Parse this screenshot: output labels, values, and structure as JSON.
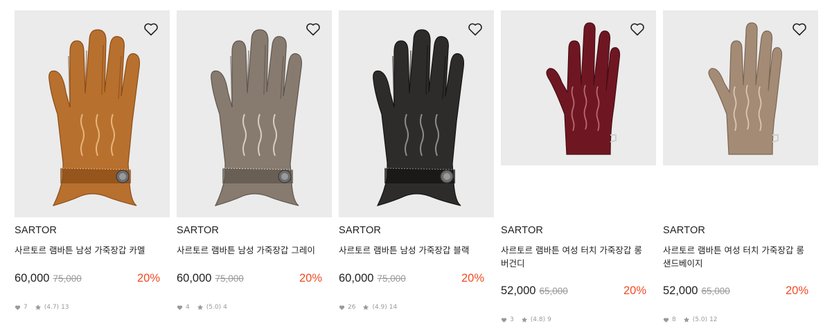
{
  "products": [
    {
      "brand": "SARTOR",
      "name": "사르토르 램바튼 남성 가죽장갑 카멜",
      "price": "60,000",
      "original_price": "75,000",
      "discount": "20%",
      "likes": "7",
      "rating": "(4.7)",
      "reviews": "13",
      "color": "#b8702e",
      "color_dark": "#8a4c18",
      "stitch": "#e9b57a",
      "style": "men"
    },
    {
      "brand": "SARTOR",
      "name": "사르토르 램바튼 남성 가죽장갑 그레이",
      "price": "60,000",
      "original_price": "75,000",
      "discount": "20%",
      "likes": "4",
      "rating": "(5.0)",
      "reviews": "4",
      "color": "#877b70",
      "color_dark": "#5f554c",
      "stitch": "#d8cec2",
      "style": "men"
    },
    {
      "brand": "SARTOR",
      "name": "사르토르 램바튼 남성 가죽장갑 블랙",
      "price": "60,000",
      "original_price": "75,000",
      "discount": "20%",
      "likes": "26",
      "rating": "(4.9)",
      "reviews": "14",
      "color": "#2e2c2b",
      "color_dark": "#141313",
      "stitch": "#8f8c88",
      "style": "men"
    },
    {
      "brand": "SARTOR",
      "name": "사르토르 램바튼 여성 터치 가죽장갑 롱 버건디",
      "price": "52,000",
      "original_price": "65,000",
      "discount": "20%",
      "likes": "3",
      "rating": "(4.8)",
      "reviews": "9",
      "color": "#6e1722",
      "color_dark": "#4a0c14",
      "stitch": "#b96a6f",
      "style": "women"
    },
    {
      "brand": "SARTOR",
      "name": "사르토르 램바튼 여성 터치 가죽장갑 롱 샌드베이지",
      "price": "52,000",
      "original_price": "65,000",
      "discount": "20%",
      "likes": "8",
      "rating": "(5.0)",
      "reviews": "12",
      "color": "#a48b75",
      "color_dark": "#7c6653",
      "stitch": "#d9c7b3",
      "style": "women"
    }
  ]
}
